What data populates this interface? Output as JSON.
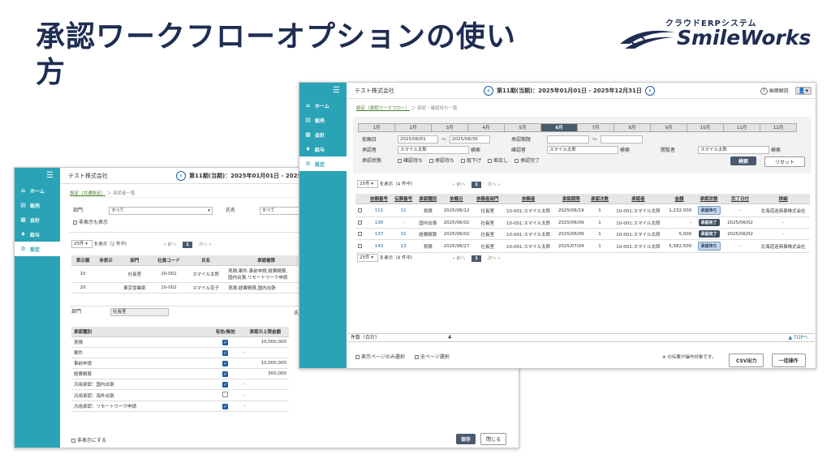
{
  "slide": {
    "title": "承認ワークフローオプションの使い方"
  },
  "logo": {
    "small": "クラウドERPシステム",
    "big": "SmileWorks"
  },
  "sidebar": {
    "items": [
      {
        "icon": "⌂",
        "label": "ホーム"
      },
      {
        "icon": "▤",
        "label": "販売"
      },
      {
        "icon": "▦",
        "label": "会計"
      },
      {
        "icon": "♦",
        "label": "給与"
      },
      {
        "icon": "⚙",
        "label": "設定"
      }
    ]
  },
  "win_back": {
    "company": "テスト株式会社",
    "period": "第11期(当期)：2025年01月01日 - 2025年12",
    "crumb_link": "設定（共通設定）",
    "crumb_rest": "＞ 承認者一覧",
    "dept_label": "部門",
    "dept_value": "すべて",
    "name_label": "氏名",
    "name_value": "すべて",
    "show_hidden": "非表示も表示",
    "pager": {
      "size": "25件",
      "text": "を表示（2 件中）",
      "prev2": "«",
      "prev": "前へ",
      "cur": "1",
      "next": "次へ",
      "next2": "»"
    },
    "cols": [
      "表示順",
      "非表示",
      "部門",
      "社員コード",
      "氏名",
      "承認権限"
    ],
    "rows": [
      {
        "order": "10",
        "hidden": "",
        "dept": "社長室",
        "code": "10-001",
        "name": "スマイル太郎",
        "rights": "見積,案件,事前申請,経費精算,",
        "rights2": "国内出張,リモートワーク申請"
      },
      {
        "order": "20",
        "hidden": "",
        "dept": "東京営業部",
        "code": "10-002",
        "name": "スマイル花子",
        "rights": "見積,経費精算,国内出張",
        "rights2": ""
      }
    ],
    "detail_dept_label": "部門",
    "detail_dept_value": "社長室",
    "detail_right_label": "氏",
    "dcols": [
      "承認種別",
      "有効/無効",
      "承認の上限金額"
    ],
    "drows": [
      {
        "type": "見積",
        "on": true,
        "limit": "10,000,000"
      },
      {
        "type": "案件",
        "on": true,
        "limit": "-"
      },
      {
        "type": "事前申請",
        "on": true,
        "limit": "10,000,000"
      },
      {
        "type": "経費精算",
        "on": true,
        "limit": "300,000"
      },
      {
        "type": "汎用承認：国内出張",
        "on": true,
        "limit": "-"
      },
      {
        "type": "汎用承認：海外出張",
        "on": false,
        "limit": "-"
      },
      {
        "type": "汎用承認：リモートワーク申請",
        "on": true,
        "limit": "-"
      }
    ],
    "hide_label": "非表示にする",
    "save": "保存",
    "close": "閉じる"
  },
  "win_front": {
    "company": "テスト株式会社",
    "period": "第11期(当期)：2025年01月01日 - 2025年12月31日",
    "help": "画面解説",
    "crumb_link": "設定（承認ワークフロー）",
    "crumb_rest": "＞ 承認・確認待ち一覧",
    "months": [
      "1月",
      "2月",
      "3月",
      "4月",
      "5月",
      "6月",
      "7月",
      "8月",
      "9月",
      "10月",
      "11月",
      "12月"
    ],
    "selected_month": "6月",
    "filters": {
      "date_label": "依頼日",
      "date_from": "2025/06/01",
      "tilde": "〜",
      "date_to": "2025/06/30",
      "period_label": "承認期限",
      "period_from": "",
      "period_to": "",
      "approver_label": "承認者",
      "approver_value": "スマイル太郎",
      "search_btn": "検索",
      "confirmer_label": "確認者",
      "confirmer_value": "スマイル太郎",
      "viewer_label": "閲覧者",
      "viewer_value": "スマイル太郎",
      "status_label": "承認状態",
      "statuses": [
        "確認待ち",
        "承認待ち",
        "取下げ",
        "差戻し",
        "承認完了"
      ],
      "search": "検索",
      "reset": "リセット"
    },
    "pager": {
      "size": "25件",
      "text": "を表示（4 件中）",
      "prev2": "«",
      "prev": "前へ",
      "cur": "1",
      "next": "次へ",
      "next2": "»"
    },
    "cols": [
      "依頼番号",
      "伝票番号",
      "承認種別",
      "依頼日",
      "依頼者部門",
      "依頼者",
      "承認期限",
      "承認次数",
      "承認者",
      "金額",
      "承認状態",
      "完了日付",
      "詳細"
    ],
    "rows": [
      {
        "no": "111",
        "slip": "11",
        "type": "見積",
        "date": "2025/06/12",
        "dept": "社長室",
        "req": "10-001:スマイル太郎",
        "due": "2025/06/19",
        "level": "1",
        "appr": "10-001:スマイル太郎",
        "amt": "1,232,000",
        "status": "承認待ち",
        "done": "-",
        "detail": "北海道送商事株式会社"
      },
      {
        "no": "136",
        "slip": "-",
        "type": "国内出張",
        "date": "2025/06/02",
        "dept": "社長室",
        "req": "10-001:スマイル太郎",
        "due": "2025/06/09",
        "level": "1",
        "appr": "10-001:スマイル太郎",
        "amt": "-",
        "status": "承認完了",
        "done": "2025/06/02",
        "detail": "-"
      },
      {
        "no": "137",
        "slip": "31",
        "type": "経費精算",
        "date": "2025/06/02",
        "dept": "社長室",
        "req": "10-001:スマイル太郎",
        "due": "2025/06/09",
        "level": "1",
        "appr": "10-001:スマイル太郎",
        "amt": "5,000",
        "status": "承認完了",
        "done": "2025/06/02",
        "detail": "-"
      },
      {
        "no": "143",
        "slip": "13",
        "type": "見積",
        "date": "2025/06/27",
        "dept": "社長室",
        "req": "10-001:スマイル太郎",
        "due": "2025/07/04",
        "level": "1",
        "appr": "10-001:スマイル太郎",
        "amt": "5,582,500",
        "status": "承認待ち",
        "done": "-",
        "detail": "北海道送商事株式会社"
      }
    ],
    "count_label": "件数（合計）",
    "count_value": "4",
    "top": "▲ TOPへ",
    "sel_page": "表示ページのみ選択",
    "sel_all": "全ページ選択",
    "note": "※ の伝票が操作対象です。",
    "csv": "CSV出力",
    "bulk": "一括操作"
  },
  "colors": {
    "sidebar": "#2aa3b6",
    "title": "#1e2d52",
    "dark_button": "#4a5a6e",
    "accent": "#1f5fa0"
  }
}
